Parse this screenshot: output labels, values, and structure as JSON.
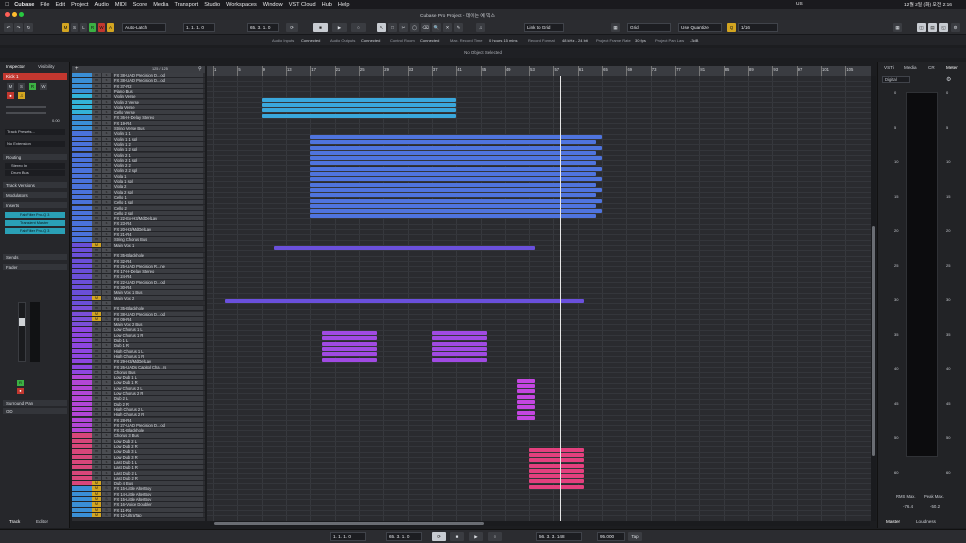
{
  "menubar": {
    "apple": "",
    "app": "Cubase",
    "items": [
      "File",
      "Edit",
      "Project",
      "Audio",
      "MIDI",
      "Score",
      "Media",
      "Transport",
      "Studio",
      "Workspaces",
      "Window",
      "VST Cloud",
      "Hub",
      "Help"
    ],
    "clock": "12월 2일 (화) 오전 2:16",
    "lang": "US"
  },
  "window": {
    "title": "Cubase Pro Project - 데이는 예 믹스"
  },
  "toolbar": {
    "mode_buttons": [
      "M",
      "S",
      "L",
      "R",
      "W",
      "A"
    ],
    "automation": "Auto-Latch",
    "position_left": "1. 1. 1. 0",
    "position_right": "65. 3. 1. 0",
    "link": "Link to Grid",
    "grid": "Grid",
    "quantize": "Use Quantize",
    "quantize_value": "1/16"
  },
  "statusline": {
    "audio_inputs": "Audio Inputs",
    "ai_state": "Connected",
    "audio_outputs": "Audio Outputs",
    "ao_state": "Connected",
    "control_room": "Control Room",
    "cr_state": "Connected",
    "max_record": "Max. Record Time",
    "max_record_val": "0 hours 15 mins",
    "record_format": "Record Format",
    "format_val": "48 kHz - 24 bit",
    "frame_rate": "Project Frame Rate",
    "frame_val": "30 fps",
    "pan_law": "Project Pan Law",
    "pan_val": "-3dB"
  },
  "info": {
    "text": "No Object Selected"
  },
  "inspector": {
    "tabs": [
      "Inspector",
      "Visibility"
    ],
    "track_name": "Kick 1",
    "routing": "Routing",
    "routing_in": "Stereo In",
    "routing_out": "Drum Bus",
    "track_presets": "Track Presets...",
    "no_ext": "No Extension",
    "sections": [
      "Track Versions",
      "Modulators",
      "Inserts",
      "Sends",
      "Fader",
      "Surround Pan",
      "OD"
    ],
    "inserts": [
      "FabFilter Pro-Q 3",
      "Transient Master",
      "FabFilter Pro-Q 3"
    ],
    "volume": "0.00",
    "bottom_tabs": [
      "Track",
      "Editor"
    ]
  },
  "tracklist": {
    "count": "125 / 125",
    "tracks": [
      {
        "n": "FX 38-UAD Precision D...od",
        "c": "#3a8fd6",
        "m": "m",
        "s": "s"
      },
      {
        "n": "FX 38-UAD Precision D...od",
        "c": "#3a8fd6",
        "m": "m",
        "s": "s"
      },
      {
        "n": "FX 37-R2",
        "c": "#3a8fd6",
        "m": "m",
        "s": "s"
      },
      {
        "n": "Piano Bus",
        "c": "#3a8fd6",
        "m": "m",
        "s": "s"
      },
      {
        "n": "Violin Verse",
        "c": "#33b3d8",
        "m": "m",
        "s": "s"
      },
      {
        "n": "Violin 2 Verse",
        "c": "#33b3d8",
        "m": "m",
        "s": "s"
      },
      {
        "n": "Viola Verse",
        "c": "#33b3d8",
        "m": "m",
        "s": "s"
      },
      {
        "n": "Cello Verse",
        "c": "#33b3d8",
        "m": "m",
        "s": "s"
      },
      {
        "n": "FX 36-H-Delay Stereo",
        "c": "#3a8fd6",
        "m": "m",
        "s": "s"
      },
      {
        "n": "FX 19-R4",
        "c": "#3a8fd6",
        "m": "m",
        "s": "s"
      },
      {
        "n": "String Verse Bus",
        "c": "#3a8fd6",
        "m": "m",
        "s": "s"
      },
      {
        "n": "Violin 1 1",
        "c": "#4a72db",
        "m": "m",
        "s": "s"
      },
      {
        "n": "Violin 1 1 spl",
        "c": "#4a72db",
        "m": "m",
        "s": "s"
      },
      {
        "n": "Violin 1 2",
        "c": "#4a72db",
        "m": "m",
        "s": "s"
      },
      {
        "n": "Violin 1 2 spl",
        "c": "#4a72db",
        "m": "m",
        "s": "s"
      },
      {
        "n": "Violin 2 1",
        "c": "#4a72db",
        "m": "m",
        "s": "s"
      },
      {
        "n": "Violin 2 1 spl",
        "c": "#4a72db",
        "m": "m",
        "s": "s"
      },
      {
        "n": "Violin 2 2",
        "c": "#4a72db",
        "m": "m",
        "s": "s"
      },
      {
        "n": "Violin 2 2 spl",
        "c": "#4a72db",
        "m": "m",
        "s": "s"
      },
      {
        "n": "Viola 1",
        "c": "#4a72db",
        "m": "m",
        "s": "s"
      },
      {
        "n": "Viola 1 spl",
        "c": "#4a72db",
        "m": "m",
        "s": "s"
      },
      {
        "n": "Viola 2",
        "c": "#4a72db",
        "m": "m",
        "s": "s"
      },
      {
        "n": "Viola 2 spl",
        "c": "#4a72db",
        "m": "m",
        "s": "s"
      },
      {
        "n": "Cello 1",
        "c": "#4a72db",
        "m": "m",
        "s": "s"
      },
      {
        "n": "Cello 1 spl",
        "c": "#4a72db",
        "m": "m",
        "s": "s"
      },
      {
        "n": "Cello 2",
        "c": "#4a72db",
        "m": "m",
        "s": "s"
      },
      {
        "n": "Cello 2 spl",
        "c": "#4a72db",
        "m": "m",
        "s": "s"
      },
      {
        "n": "FX 22-Ex-H3/MdDelLav",
        "c": "#4a72db",
        "m": "m",
        "s": "s"
      },
      {
        "n": "FX 23-R4",
        "c": "#4a72db",
        "m": "m",
        "s": "s"
      },
      {
        "n": "FX 20-H3/MdDelLav",
        "c": "#4a72db",
        "m": "m",
        "s": "s"
      },
      {
        "n": "FX 21-R4",
        "c": "#4a72db",
        "m": "m",
        "s": "s"
      },
      {
        "n": "String Chorus Bus",
        "c": "#4a72db",
        "m": "m",
        "s": "s"
      },
      {
        "n": "Main Vox 1",
        "c": "#6a4fd8",
        "m": "M",
        "s": "S",
        "y": true
      },
      {
        "n": "",
        "c": "#6a4fd8",
        "m": "m",
        "s": "s"
      },
      {
        "n": "FX 35-Blackhole",
        "c": "#6a4fd8",
        "m": "m",
        "s": "s"
      },
      {
        "n": "FX 32-R4",
        "c": "#6a4fd8",
        "m": "m",
        "s": "s"
      },
      {
        "n": "FX 25-UAD Precision R...ne",
        "c": "#6a4fd8",
        "m": "m",
        "s": "s"
      },
      {
        "n": "FX 17-H-Delay Stereo",
        "c": "#6a4fd8",
        "m": "m",
        "s": "s"
      },
      {
        "n": "FX 24-R4",
        "c": "#6a4fd8",
        "m": "m",
        "s": "s"
      },
      {
        "n": "FX 22-UAD Precision D...od",
        "c": "#6a4fd8",
        "m": "m",
        "s": "s"
      },
      {
        "n": "FX 30-R4",
        "c": "#6a4fd8",
        "m": "m",
        "s": "s"
      },
      {
        "n": "Main Vox 1 Bus",
        "c": "#6a4fd8",
        "m": "m",
        "s": "s"
      },
      {
        "n": "Main Vox 2",
        "c": "#6a4fd8",
        "m": "M",
        "s": "S",
        "y": true
      },
      {
        "n": "",
        "c": "#6a4fd8",
        "m": "m",
        "s": "s"
      },
      {
        "n": "FX 35-Blackhole",
        "c": "#7a4fd8",
        "m": "m",
        "s": "s"
      },
      {
        "n": "FX 38-UAD Precision D...od",
        "c": "#7a4fd8",
        "m": "M",
        "s": "S",
        "y": true
      },
      {
        "n": "FX 09-R4",
        "c": "#7a4fd8",
        "m": "M",
        "s": "S",
        "y": true
      },
      {
        "n": "Main Vox 2 Bus",
        "c": "#7a4fd8",
        "m": "m",
        "s": "s"
      },
      {
        "n": "Low Chorus 1 L",
        "c": "#8e46e0",
        "m": "m",
        "s": "s"
      },
      {
        "n": "Low Chorus 1 R",
        "c": "#8e46e0",
        "m": "m",
        "s": "s"
      },
      {
        "n": "Dub 1 L",
        "c": "#8e46e0",
        "m": "m",
        "s": "s"
      },
      {
        "n": "Dub 1 R",
        "c": "#8e46e0",
        "m": "m",
        "s": "s"
      },
      {
        "n": "High Chorus 1 L",
        "c": "#8e46e0",
        "m": "m",
        "s": "s"
      },
      {
        "n": "High Chorus 1 R",
        "c": "#8e46e0",
        "m": "m",
        "s": "s"
      },
      {
        "n": "FX 29-H3/MdDelLav",
        "c": "#8e46e0",
        "m": "m",
        "s": "s"
      },
      {
        "n": "FX 26-UADs Capitol Cha...rs",
        "c": "#8e46e0",
        "m": "m",
        "s": "s"
      },
      {
        "n": "Chorus Bus",
        "c": "#8e46e0",
        "m": "m",
        "s": "s"
      },
      {
        "n": "Low Dub 1 L",
        "c": "#b246d6",
        "m": "m",
        "s": "s"
      },
      {
        "n": "Low Dub 1 R",
        "c": "#b246d6",
        "m": "m",
        "s": "s"
      },
      {
        "n": "Low Chorus 2 L",
        "c": "#b246d6",
        "m": "m",
        "s": "s"
      },
      {
        "n": "Low Chorus 2 R",
        "c": "#b246d6",
        "m": "m",
        "s": "s"
      },
      {
        "n": "Dub 2 L",
        "c": "#b246d6",
        "m": "m",
        "s": "s"
      },
      {
        "n": "Dub 2 R",
        "c": "#b246d6",
        "m": "m",
        "s": "s"
      },
      {
        "n": "High Chorus 2 L",
        "c": "#b246d6",
        "m": "m",
        "s": "s"
      },
      {
        "n": "High Chorus 2 R",
        "c": "#b246d6",
        "m": "m",
        "s": "s"
      },
      {
        "n": "FX 28-R4",
        "c": "#b246d6",
        "m": "m",
        "s": "s"
      },
      {
        "n": "FX 27-UAD Precision D...od",
        "c": "#b246d6",
        "m": "m",
        "s": "s"
      },
      {
        "n": "FX 31-Blackhole",
        "c": "#b246d6",
        "m": "m",
        "s": "s"
      },
      {
        "n": "Chorus 3 Bus",
        "c": "#d8467a",
        "m": "m",
        "s": "s"
      },
      {
        "n": "Low Dub 2 L",
        "c": "#d8467a",
        "m": "m",
        "s": "s"
      },
      {
        "n": "Low Dub 2 R",
        "c": "#d8467a",
        "m": "m",
        "s": "s"
      },
      {
        "n": "Low Dub 3 L",
        "c": "#d8467a",
        "m": "m",
        "s": "s"
      },
      {
        "n": "Low Dub 3 R",
        "c": "#d8467a",
        "m": "m",
        "s": "s"
      },
      {
        "n": "Last Dub 1 L",
        "c": "#d8467a",
        "m": "m",
        "s": "s"
      },
      {
        "n": "Last Dub 1 R",
        "c": "#d8467a",
        "m": "m",
        "s": "s"
      },
      {
        "n": "Last Dub 2 L",
        "c": "#d8467a",
        "m": "m",
        "s": "s"
      },
      {
        "n": "Last Dub 2 R",
        "c": "#d8467a",
        "m": "m",
        "s": "s"
      },
      {
        "n": "Dub 4 Bus",
        "c": "#d8467a",
        "m": "M",
        "s": "S",
        "y": true
      },
      {
        "n": "FX 15-Little AlterBoy",
        "c": "#3a8fd6",
        "m": "M",
        "s": "S",
        "y": true
      },
      {
        "n": "FX 14-Little AlterBoy",
        "c": "#3a8fd6",
        "m": "M",
        "s": "S",
        "y": true
      },
      {
        "n": "FX 15-Little AlterBoy",
        "c": "#3a8fd6",
        "m": "M",
        "s": "S",
        "y": true
      },
      {
        "n": "FX 16-Voice Doubler",
        "c": "#3a8fd6",
        "m": "M",
        "s": "S",
        "y": true
      },
      {
        "n": "FX 11-R4",
        "c": "#3a8fd6",
        "m": "M",
        "s": "S",
        "y": true
      },
      {
        "n": "FX 12-UltraTap",
        "c": "#3a8fd6",
        "m": "M",
        "s": "S",
        "y": true
      }
    ]
  },
  "ruler": {
    "bars": [
      "1",
      "5",
      "9",
      "13",
      "17",
      "21",
      "25",
      "29",
      "33",
      "37",
      "41",
      "45",
      "49",
      "53",
      "57",
      "61",
      "65",
      "69",
      "73",
      "77",
      "81",
      "85",
      "89",
      "93",
      "97",
      "101",
      "105"
    ]
  },
  "parts": [
    {
      "track": 4,
      "start": 9,
      "end": 41,
      "color": "#3aa7db"
    },
    {
      "track": 5,
      "start": 9,
      "end": 41,
      "color": "#3aa7db"
    },
    {
      "track": 6,
      "start": 9,
      "end": 41,
      "color": "#3aa7db"
    },
    {
      "track": 7,
      "start": 9,
      "end": 41,
      "color": "#3aa7db"
    },
    {
      "track": 11,
      "start": 17,
      "end": 65,
      "color": "#4f74de"
    },
    {
      "track": 12,
      "start": 17,
      "end": 64,
      "color": "#4f74de"
    },
    {
      "track": 13,
      "start": 17,
      "end": 65,
      "color": "#4f74de"
    },
    {
      "track": 14,
      "start": 17,
      "end": 64,
      "color": "#4f74de"
    },
    {
      "track": 15,
      "start": 17,
      "end": 65,
      "color": "#4f74de"
    },
    {
      "track": 16,
      "start": 17,
      "end": 64,
      "color": "#4f74de"
    },
    {
      "track": 17,
      "start": 17,
      "end": 65,
      "color": "#4f74de"
    },
    {
      "track": 18,
      "start": 17,
      "end": 64,
      "color": "#4f74de"
    },
    {
      "track": 19,
      "start": 17,
      "end": 65,
      "color": "#4f74de"
    },
    {
      "track": 20,
      "start": 17,
      "end": 64,
      "color": "#4f74de"
    },
    {
      "track": 21,
      "start": 17,
      "end": 65,
      "color": "#4f74de"
    },
    {
      "track": 22,
      "start": 17,
      "end": 64,
      "color": "#4f74de"
    },
    {
      "track": 23,
      "start": 17,
      "end": 65,
      "color": "#4f74de"
    },
    {
      "track": 24,
      "start": 17,
      "end": 64,
      "color": "#4f74de"
    },
    {
      "track": 25,
      "start": 17,
      "end": 65,
      "color": "#4f74de"
    },
    {
      "track": 26,
      "start": 17,
      "end": 64,
      "color": "#4f74de"
    },
    {
      "track": 32,
      "start": 11,
      "end": 54,
      "color": "#6a50dc"
    },
    {
      "track": 42,
      "start": 3,
      "end": 62,
      "color": "#6a50dc"
    },
    {
      "track": 48,
      "start": 19,
      "end": 28,
      "color": "#a04ae2"
    },
    {
      "track": 49,
      "start": 19,
      "end": 28,
      "color": "#a04ae2"
    },
    {
      "track": 50,
      "start": 19,
      "end": 28,
      "color": "#a04ae2"
    },
    {
      "track": 51,
      "start": 19,
      "end": 28,
      "color": "#a04ae2"
    },
    {
      "track": 52,
      "start": 19,
      "end": 28,
      "color": "#a04ae2"
    },
    {
      "track": 53,
      "start": 19,
      "end": 28,
      "color": "#a04ae2"
    },
    {
      "track": 48,
      "start": 37,
      "end": 46,
      "color": "#a04ae2"
    },
    {
      "track": 49,
      "start": 37,
      "end": 46,
      "color": "#a04ae2"
    },
    {
      "track": 50,
      "start": 37,
      "end": 46,
      "color": "#a04ae2"
    },
    {
      "track": 51,
      "start": 37,
      "end": 46,
      "color": "#a04ae2"
    },
    {
      "track": 52,
      "start": 37,
      "end": 46,
      "color": "#a04ae2"
    },
    {
      "track": 53,
      "start": 37,
      "end": 46,
      "color": "#a04ae2"
    },
    {
      "track": 57,
      "start": 51,
      "end": 54,
      "color": "#c446e0"
    },
    {
      "track": 58,
      "start": 51,
      "end": 54,
      "color": "#c446e0"
    },
    {
      "track": 59,
      "start": 51,
      "end": 54,
      "color": "#c446e0"
    },
    {
      "track": 60,
      "start": 51,
      "end": 54,
      "color": "#c446e0"
    },
    {
      "track": 61,
      "start": 51,
      "end": 54,
      "color": "#c446e0"
    },
    {
      "track": 62,
      "start": 51,
      "end": 54,
      "color": "#c446e0"
    },
    {
      "track": 63,
      "start": 51,
      "end": 54,
      "color": "#c446e0"
    },
    {
      "track": 64,
      "start": 51,
      "end": 54,
      "color": "#c446e0"
    },
    {
      "track": 70,
      "start": 53,
      "end": 62,
      "color": "#e4407e"
    },
    {
      "track": 71,
      "start": 53,
      "end": 62,
      "color": "#e4407e"
    },
    {
      "track": 72,
      "start": 53,
      "end": 62,
      "color": "#e4407e"
    },
    {
      "track": 73,
      "start": 53,
      "end": 62,
      "color": "#e4407e"
    },
    {
      "track": 74,
      "start": 53,
      "end": 62,
      "color": "#e4407e"
    },
    {
      "track": 75,
      "start": 53,
      "end": 62,
      "color": "#e4407e"
    },
    {
      "track": 76,
      "start": 53,
      "end": 62,
      "color": "#e4407e"
    },
    {
      "track": 77,
      "start": 53,
      "end": 62,
      "color": "#e4407e"
    }
  ],
  "cursor_bar": "58",
  "right": {
    "tabs": [
      "VSTi",
      "Media",
      "CR",
      "Meter"
    ],
    "mode": "Digital",
    "meter_scale": [
      "0",
      "5",
      "10",
      "15",
      "20",
      "25",
      "30",
      "35",
      "40",
      "45",
      "50",
      "60"
    ],
    "rms_label": "RMS Max.",
    "peak_label": "Peak Max.",
    "rms": "-76.4",
    "peak": "-50.2",
    "bottom_tabs": [
      "Master",
      "Loudness"
    ]
  },
  "bottom": {
    "position_left": "1. 1. 1. 0",
    "position_right": "65. 3. 1. 0",
    "position": "56. 3. 3. 148",
    "tempo": "95.000",
    "tap": "Tap"
  }
}
